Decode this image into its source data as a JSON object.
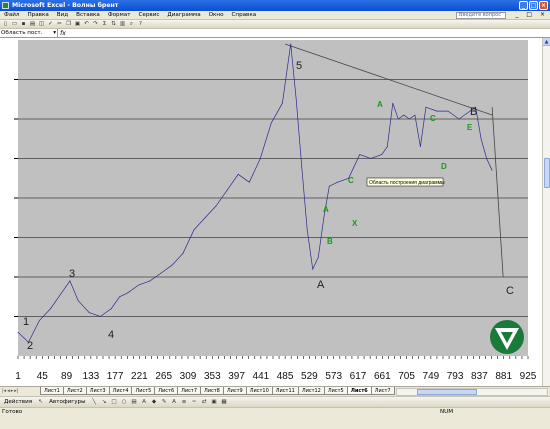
{
  "window": {
    "title": "Microsoft Excel - Волны брент"
  },
  "menu": {
    "items": [
      "Файл",
      "Правка",
      "Вид",
      "Вставка",
      "Формат",
      "Сервис",
      "Диаграмма",
      "Окно",
      "Справка"
    ],
    "help_placeholder": "Введите вопрос"
  },
  "formula": {
    "name_box": "Область пост.",
    "fx": "fx"
  },
  "chart": {
    "tooltip": "Область построения диаграммы",
    "wave_labels": [
      "1",
      "2",
      "3",
      "4",
      "5",
      "A",
      "B",
      "C"
    ],
    "corrective_labels": [
      "A",
      "B",
      "C",
      "X",
      "A",
      "B",
      "C",
      "D",
      "E"
    ],
    "x_ticks": [
      "1",
      "45",
      "89",
      "133",
      "177",
      "221",
      "265",
      "309",
      "353",
      "397",
      "441",
      "485",
      "529",
      "573",
      "617",
      "661",
      "705",
      "749",
      "793",
      "837",
      "881",
      "925"
    ]
  },
  "chart_data": {
    "type": "line",
    "x_tick_labels": [
      "1",
      "45",
      "89",
      "133",
      "177",
      "221",
      "265",
      "309",
      "353",
      "397",
      "441",
      "485",
      "529",
      "573",
      "617",
      "661",
      "705",
      "749",
      "793",
      "837",
      "881",
      "925"
    ],
    "xlim": [
      1,
      925
    ],
    "ylim": [
      0,
      8
    ],
    "grid": true,
    "series": [
      {
        "x": [
          1,
          20,
          40,
          60,
          80,
          95,
          110,
          130,
          150,
          170,
          185,
          200,
          220,
          240,
          260,
          280,
          300,
          320,
          340,
          360,
          380,
          400,
          420,
          440,
          460,
          480,
          495,
          505,
          515,
          525,
          535,
          545,
          555,
          565,
          580,
          600,
          620,
          640,
          660,
          670,
          680,
          690,
          700,
          710,
          720,
          730,
          740,
          760,
          780,
          800,
          820,
          830,
          840,
          850,
          860
        ],
        "y": [
          0.6,
          0.35,
          0.9,
          1.2,
          1.6,
          1.9,
          1.4,
          1.1,
          1.0,
          1.2,
          1.5,
          1.6,
          1.8,
          1.9,
          2.1,
          2.3,
          2.6,
          3.2,
          3.5,
          3.8,
          4.2,
          4.6,
          4.4,
          5.0,
          5.9,
          6.4,
          7.9,
          6.5,
          4.8,
          3.2,
          2.2,
          2.5,
          3.5,
          4.3,
          4.4,
          4.5,
          5.1,
          5.0,
          5.1,
          5.3,
          6.4,
          6.0,
          6.1,
          6.0,
          6.1,
          5.3,
          6.3,
          6.2,
          6.2,
          6.0,
          6.2,
          6.3,
          5.5,
          5.0,
          4.7
        ]
      }
    ],
    "trendline": {
      "x": [
        485,
        860
      ],
      "y": [
        7.9,
        6.1
      ]
    },
    "projection": {
      "x": [
        860,
        880
      ],
      "y": [
        6.3,
        2.0
      ]
    }
  },
  "tabs": [
    "Лист1",
    "Лист2",
    "Лист3",
    "Лист4",
    "Лист5",
    "Лист6",
    "Лист7",
    "Лист8",
    "Лист9",
    "Лист10",
    "Лист11",
    "Лист12",
    "Лист5",
    "Лист6",
    "Лист7"
  ],
  "active_tab": 13,
  "drawbar": {
    "actions": "Действия",
    "autoshapes": "Автофигуры"
  },
  "status": {
    "ready": "Готово",
    "num": "NUM"
  }
}
